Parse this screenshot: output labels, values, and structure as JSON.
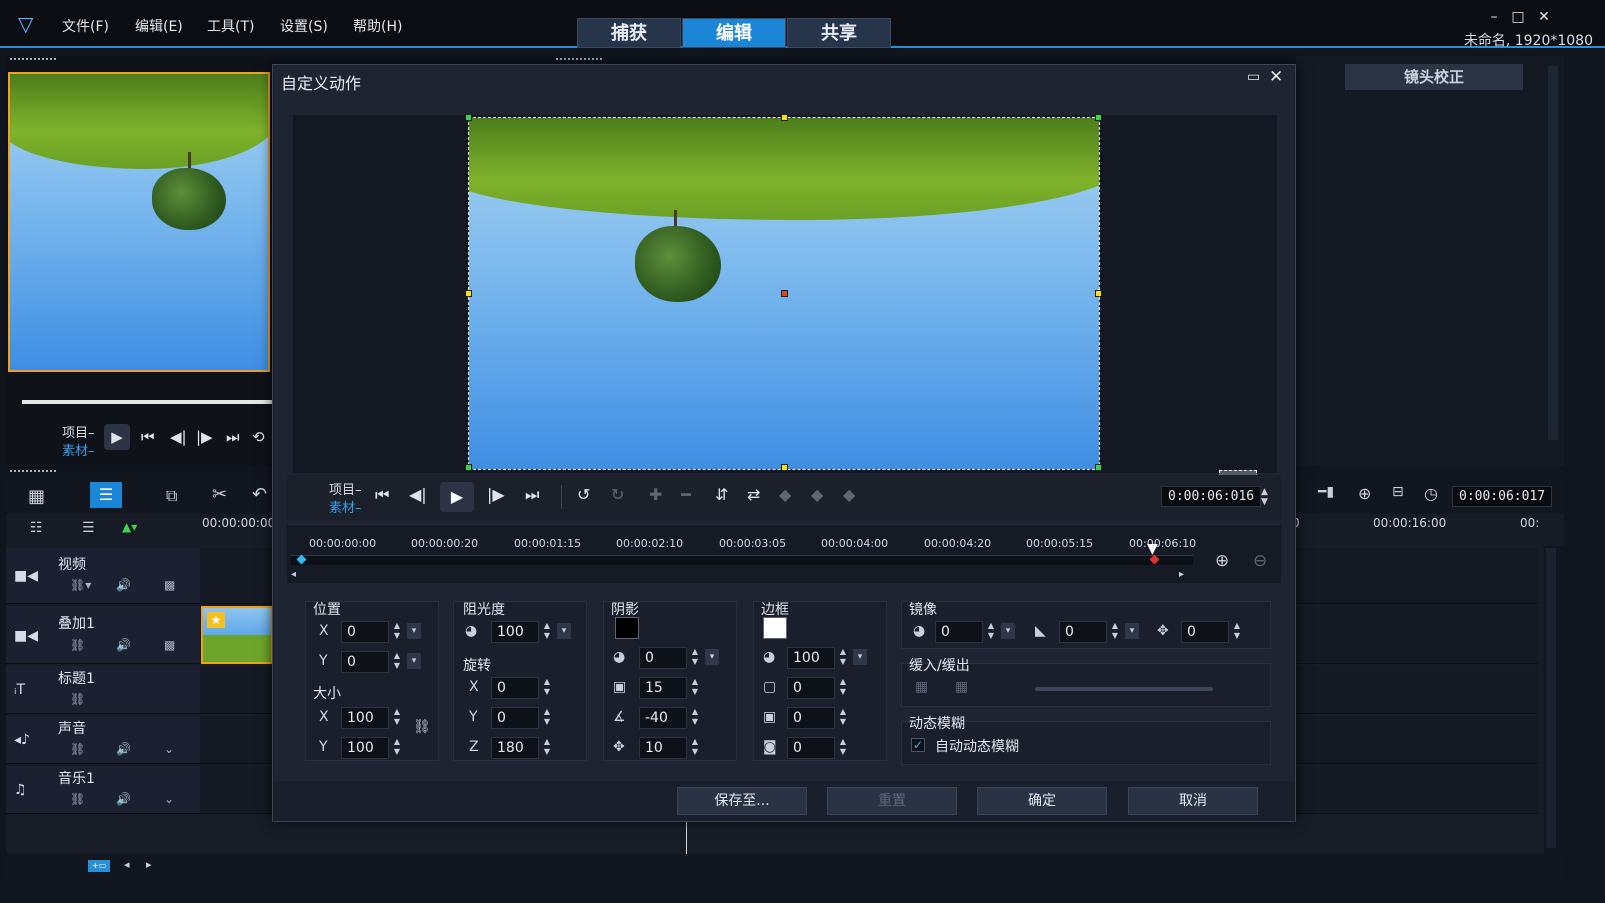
{
  "app": {
    "menus": [
      "文件(F)",
      "编辑(E)",
      "工具(T)",
      "设置(S)",
      "帮助(H)"
    ],
    "modes": [
      "捕获",
      "编辑",
      "共享"
    ],
    "active_mode": "编辑",
    "project_info": "未命名, 1920*1080"
  },
  "player": {
    "project_label": "项目–",
    "clip_label": "素材–"
  },
  "right_panel": {
    "tab_label": "镜头校正"
  },
  "timeline": {
    "start_timecode": "00:00:00:00",
    "later_timecode": "00:00:16:00",
    "partial_tick": "00:",
    "left_partial": "0",
    "timecode": "0:00:06:017",
    "tracks": [
      {
        "name": "视频",
        "icon": "video-track-icon"
      },
      {
        "name": "叠加1",
        "icon": "overlay-track-icon"
      },
      {
        "name": "标题1",
        "icon": "title-track-icon"
      },
      {
        "name": "声音",
        "icon": "voice-track-icon"
      },
      {
        "name": "音乐1",
        "icon": "music-track-icon"
      }
    ]
  },
  "dialog": {
    "title": "自定义动作",
    "project_label": "项目–",
    "clip_label": "素材–",
    "timecode": "0:00:06:016",
    "ruler_ticks": [
      "00:00:00:00",
      "00:00:00:20",
      "00:00:01:15",
      "00:00:02:10",
      "00:00:03:05",
      "00:00:04:00",
      "00:00:04:20",
      "00:00:05:15",
      "00:00:06:10"
    ],
    "position": {
      "label": "位置",
      "x": "0",
      "y": "0"
    },
    "size": {
      "label": "大小",
      "x": "100",
      "y": "100"
    },
    "opacity": {
      "label": "阻光度",
      "value": "100"
    },
    "rotation": {
      "label": "旋转",
      "x": "0",
      "y": "0",
      "z": "180"
    },
    "shadow": {
      "label": "阴影",
      "color": "#000000",
      "opacity": "0",
      "blur": "15",
      "angle": "-40",
      "distance": "10"
    },
    "border": {
      "label": "边框",
      "color": "#ffffff",
      "opacity": "100",
      "width": "0",
      "v2": "0",
      "v3": "0"
    },
    "mirror": {
      "label": "镜像",
      "v1": "0",
      "v2": "0",
      "v3": "0"
    },
    "ease": {
      "label": "缓入/缓出"
    },
    "motion_blur": {
      "label": "动态模糊",
      "auto_label": "自动动态模糊",
      "auto_checked": true
    },
    "buttons": {
      "save_to": "保存至...",
      "reset": "重置",
      "ok": "确定",
      "cancel": "取消"
    },
    "axis_labels": {
      "x": "X",
      "y": "Y",
      "z": "Z"
    }
  }
}
